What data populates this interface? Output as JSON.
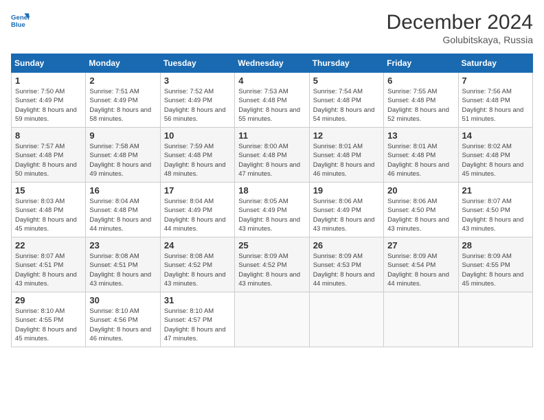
{
  "header": {
    "logo_line1": "General",
    "logo_line2": "Blue",
    "month": "December 2024",
    "location": "Golubitskaya, Russia"
  },
  "days_of_week": [
    "Sunday",
    "Monday",
    "Tuesday",
    "Wednesday",
    "Thursday",
    "Friday",
    "Saturday"
  ],
  "weeks": [
    [
      {
        "day": 1,
        "sunrise": "7:50 AM",
        "sunset": "4:49 PM",
        "daylight": "8 hours and 59 minutes."
      },
      {
        "day": 2,
        "sunrise": "7:51 AM",
        "sunset": "4:49 PM",
        "daylight": "8 hours and 58 minutes."
      },
      {
        "day": 3,
        "sunrise": "7:52 AM",
        "sunset": "4:49 PM",
        "daylight": "8 hours and 56 minutes."
      },
      {
        "day": 4,
        "sunrise": "7:53 AM",
        "sunset": "4:48 PM",
        "daylight": "8 hours and 55 minutes."
      },
      {
        "day": 5,
        "sunrise": "7:54 AM",
        "sunset": "4:48 PM",
        "daylight": "8 hours and 54 minutes."
      },
      {
        "day": 6,
        "sunrise": "7:55 AM",
        "sunset": "4:48 PM",
        "daylight": "8 hours and 52 minutes."
      },
      {
        "day": 7,
        "sunrise": "7:56 AM",
        "sunset": "4:48 PM",
        "daylight": "8 hours and 51 minutes."
      }
    ],
    [
      {
        "day": 8,
        "sunrise": "7:57 AM",
        "sunset": "4:48 PM",
        "daylight": "8 hours and 50 minutes."
      },
      {
        "day": 9,
        "sunrise": "7:58 AM",
        "sunset": "4:48 PM",
        "daylight": "8 hours and 49 minutes."
      },
      {
        "day": 10,
        "sunrise": "7:59 AM",
        "sunset": "4:48 PM",
        "daylight": "8 hours and 48 minutes."
      },
      {
        "day": 11,
        "sunrise": "8:00 AM",
        "sunset": "4:48 PM",
        "daylight": "8 hours and 47 minutes."
      },
      {
        "day": 12,
        "sunrise": "8:01 AM",
        "sunset": "4:48 PM",
        "daylight": "8 hours and 46 minutes."
      },
      {
        "day": 13,
        "sunrise": "8:01 AM",
        "sunset": "4:48 PM",
        "daylight": "8 hours and 46 minutes."
      },
      {
        "day": 14,
        "sunrise": "8:02 AM",
        "sunset": "4:48 PM",
        "daylight": "8 hours and 45 minutes."
      }
    ],
    [
      {
        "day": 15,
        "sunrise": "8:03 AM",
        "sunset": "4:48 PM",
        "daylight": "8 hours and 45 minutes."
      },
      {
        "day": 16,
        "sunrise": "8:04 AM",
        "sunset": "4:48 PM",
        "daylight": "8 hours and 44 minutes."
      },
      {
        "day": 17,
        "sunrise": "8:04 AM",
        "sunset": "4:49 PM",
        "daylight": "8 hours and 44 minutes."
      },
      {
        "day": 18,
        "sunrise": "8:05 AM",
        "sunset": "4:49 PM",
        "daylight": "8 hours and 43 minutes."
      },
      {
        "day": 19,
        "sunrise": "8:06 AM",
        "sunset": "4:49 PM",
        "daylight": "8 hours and 43 minutes."
      },
      {
        "day": 20,
        "sunrise": "8:06 AM",
        "sunset": "4:50 PM",
        "daylight": "8 hours and 43 minutes."
      },
      {
        "day": 21,
        "sunrise": "8:07 AM",
        "sunset": "4:50 PM",
        "daylight": "8 hours and 43 minutes."
      }
    ],
    [
      {
        "day": 22,
        "sunrise": "8:07 AM",
        "sunset": "4:51 PM",
        "daylight": "8 hours and 43 minutes."
      },
      {
        "day": 23,
        "sunrise": "8:08 AM",
        "sunset": "4:51 PM",
        "daylight": "8 hours and 43 minutes."
      },
      {
        "day": 24,
        "sunrise": "8:08 AM",
        "sunset": "4:52 PM",
        "daylight": "8 hours and 43 minutes."
      },
      {
        "day": 25,
        "sunrise": "8:09 AM",
        "sunset": "4:52 PM",
        "daylight": "8 hours and 43 minutes."
      },
      {
        "day": 26,
        "sunrise": "8:09 AM",
        "sunset": "4:53 PM",
        "daylight": "8 hours and 44 minutes."
      },
      {
        "day": 27,
        "sunrise": "8:09 AM",
        "sunset": "4:54 PM",
        "daylight": "8 hours and 44 minutes."
      },
      {
        "day": 28,
        "sunrise": "8:09 AM",
        "sunset": "4:55 PM",
        "daylight": "8 hours and 45 minutes."
      }
    ],
    [
      {
        "day": 29,
        "sunrise": "8:10 AM",
        "sunset": "4:55 PM",
        "daylight": "8 hours and 45 minutes."
      },
      {
        "day": 30,
        "sunrise": "8:10 AM",
        "sunset": "4:56 PM",
        "daylight": "8 hours and 46 minutes."
      },
      {
        "day": 31,
        "sunrise": "8:10 AM",
        "sunset": "4:57 PM",
        "daylight": "8 hours and 47 minutes."
      },
      null,
      null,
      null,
      null
    ]
  ]
}
